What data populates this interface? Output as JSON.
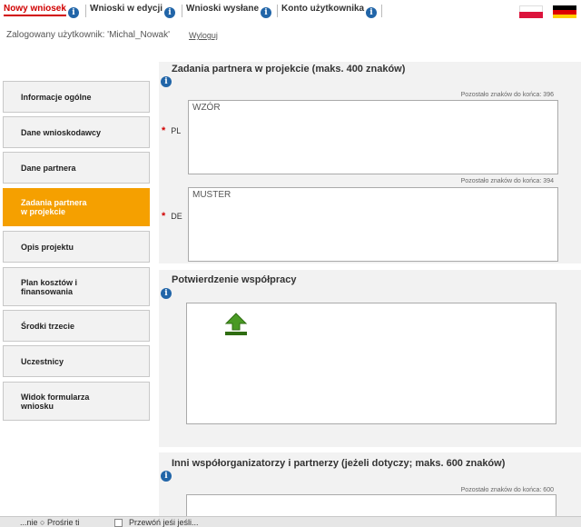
{
  "nav": {
    "tab_new": "Nowy wniosek",
    "tab_edit": "Wnioski w edycji",
    "tab_sent": "Wnioski wysłane",
    "tab_account": "Konto użytkownika",
    "info_glyph": "i"
  },
  "user": {
    "logged_in": "Zalogowany użytkownik: 'Michal_Nowak'",
    "logout": "Wyloguj"
  },
  "sidebar": {
    "items": [
      {
        "label": "Informacje ogólne"
      },
      {
        "label": "Dane wnioskodawcy"
      },
      {
        "label": "Dane partnera"
      },
      {
        "label": "Zadania partnera\nw projekcie"
      },
      {
        "label": "Opis projektu"
      },
      {
        "label": "Plan kosztów i\nfinansowania"
      },
      {
        "label": "Środki trzecie"
      },
      {
        "label": "Uczestnicy"
      },
      {
        "label": "Widok formularza\nwniosku"
      }
    ]
  },
  "tasks": {
    "title": "Zadania partnera w projekcie (maks. 400 znaków)",
    "remaining_pl": "Pozostało znaków do końca: 396",
    "remaining_de": "Pozostało znaków do końca: 394",
    "label_pl": "PL",
    "label_de": "DE",
    "required_mark": "*",
    "value_pl": "WZÓR",
    "value_de": "MUSTER"
  },
  "confirmation": {
    "title": "Potwierdzenie współpracy"
  },
  "others": {
    "title": "Inni współorganizatorzy i partnerzy (jeżeli dotyczy; maks. 600 znaków)",
    "remaining": "Pozostało znaków do końca: 600"
  },
  "bottom": {
    "text_left": "...nie  ○ Prośrie ti",
    "text_right": "Przewóń jeśi jeśli..."
  },
  "colors": {
    "active_tab": "#d10000",
    "active_menu": "#f5a000",
    "info_icon": "#2165a8",
    "upload_green": "#3b8a1e"
  }
}
